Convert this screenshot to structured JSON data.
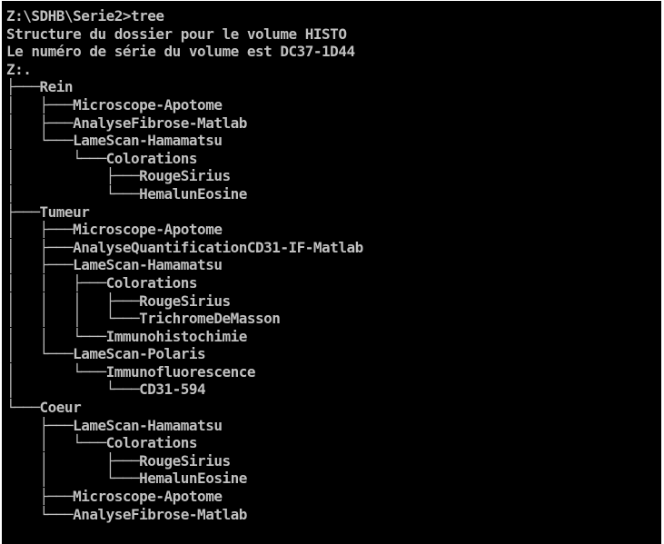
{
  "console": {
    "colors": {
      "background": "#000000",
      "text": "#c0c0c0"
    },
    "lines": [
      "Z:\\SDHB\\Serie2>tree",
      "Structure du dossier pour le volume HISTO",
      "Le numéro de série du volume est DC37-1D44",
      "Z:.",
      "├───Rein",
      "│   ├───Microscope-Apotome",
      "│   ├───AnalyseFibrose-Matlab",
      "│   └───LameScan-Hamamatsu",
      "│       └───Colorations",
      "│           ├───RougeSirius",
      "│           └───HemalunEosine",
      "├───Tumeur",
      "│   ├───Microscope-Apotome",
      "│   ├───AnalyseQuantificationCD31-IF-Matlab",
      "│   ├───LameScan-Hamamatsu",
      "│   │   ├───Colorations",
      "│   │   │   ├───RougeSirius",
      "│   │   │   └───TrichromeDeMasson",
      "│   │   └───Immunohistochimie",
      "│   └───LameScan-Polaris",
      "│       └───Immunofluorescence",
      "│           └───CD31-594",
      "└───Coeur",
      "    ├───LameScan-Hamamatsu",
      "    │   └───Colorations",
      "    │       ├───RougeSirius",
      "    │       └───HemalunEosine",
      "    ├───Microscope-Apotome",
      "    └───AnalyseFibrose-Matlab"
    ]
  }
}
